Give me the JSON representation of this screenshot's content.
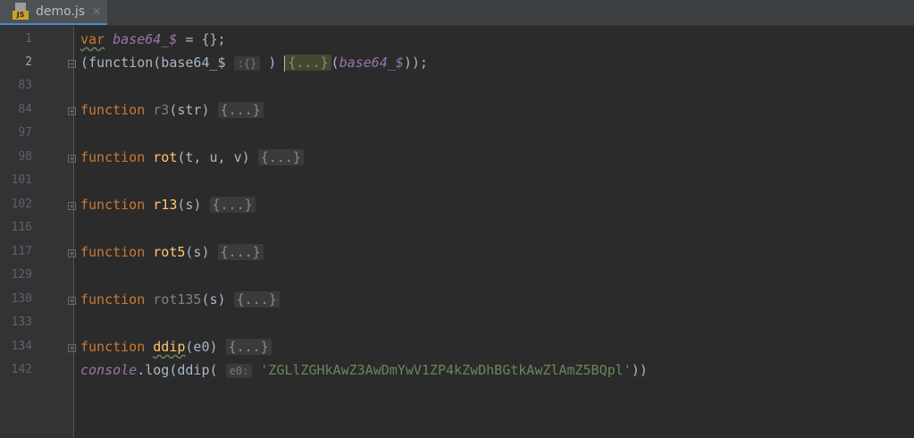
{
  "tab": {
    "title": "demo.js",
    "icon": "js-file-icon",
    "badge": "JS"
  },
  "colors": {
    "background": "#2b2b2b",
    "keyword": "#cc7832",
    "function_name": "#ffc66d",
    "string": "#6a8759",
    "global_var": "#9876aa",
    "line_number": "#606366"
  },
  "lines": [
    {
      "num": "1",
      "var_kw": "var",
      "name": "base64_$",
      "rest": " = {};"
    },
    {
      "num": "2",
      "open": "(function(base64_$ ",
      "hint": ":{}",
      "close": " ) ",
      "fold": "{...}",
      "arg": "base64_$",
      "tail": "));"
    },
    {
      "num": "83"
    },
    {
      "num": "84",
      "kw": "function",
      "name": "r3",
      "args": "(str) ",
      "fold": "{...}"
    },
    {
      "num": "97"
    },
    {
      "num": "98",
      "kw": "function",
      "name": "rot",
      "args": "(t, u, v) ",
      "fold": "{...}"
    },
    {
      "num": "101"
    },
    {
      "num": "102",
      "kw": "function",
      "name": "r13",
      "args": "(s) ",
      "fold": "{...}"
    },
    {
      "num": "116"
    },
    {
      "num": "117",
      "kw": "function",
      "name": "rot5",
      "args": "(s) ",
      "fold": "{...}"
    },
    {
      "num": "129"
    },
    {
      "num": "130",
      "kw": "function",
      "name": "rot135",
      "args": "(s) ",
      "fold": "{...}"
    },
    {
      "num": "133"
    },
    {
      "num": "134",
      "kw": "function",
      "name": "ddip",
      "args": "(e0) ",
      "fold": "{...}"
    },
    {
      "num": "142",
      "console": "console",
      "mid": ".log(ddip( ",
      "hint": "e0:",
      "str": "'ZGLlZGHkAwZ3AwDmYwV1ZP4kZwDhBGtkAwZlAmZ5BQpl'",
      "tail": "))"
    }
  ]
}
